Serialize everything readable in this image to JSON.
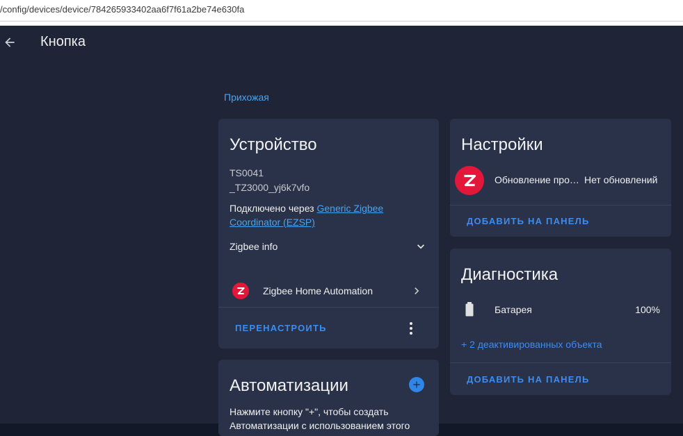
{
  "browser": {
    "url": "/config/devices/device/784265933402aa6f7f61a2be74e630fa"
  },
  "header": {
    "title": "Кнопка"
  },
  "area": {
    "label": "Прихожая"
  },
  "device_card": {
    "title": "Устройство",
    "model": "TS0041",
    "manufacturer": "_TZ3000_yj6k7vfo",
    "connected_via_label": "Подключено через",
    "connected_via_link": "Generic Zigbee Coordinator (EZSP)",
    "zigbee_info_label": "Zigbee info",
    "integration_label": "Zigbee Home Automation",
    "reconfigure_label": "ПЕРЕНАСТРОИТЬ"
  },
  "automations_card": {
    "title": "Автоматизации",
    "hint": "Нажмите кнопку \"+\", чтобы создать",
    "hint_cut": "Автоматизации с использованием этого"
  },
  "settings_card": {
    "title": "Настройки",
    "entity_name": "Обновление про…",
    "entity_state": "Нет обновлений",
    "add_to_panel": "ДОБАВИТЬ НА ПАНЕЛЬ"
  },
  "diagnostics_card": {
    "title": "Диагностика",
    "battery_label": "Батарея",
    "battery_value": "100%",
    "disabled_entities": "+ 2 деактивированных объекта",
    "add_to_panel": "ДОБАВИТЬ НА ПАНЕЛЬ"
  },
  "colors": {
    "background": "#1f2537",
    "card": "#2a3249",
    "accent": "#3d8cf0",
    "zha_red": "#e2173a"
  }
}
